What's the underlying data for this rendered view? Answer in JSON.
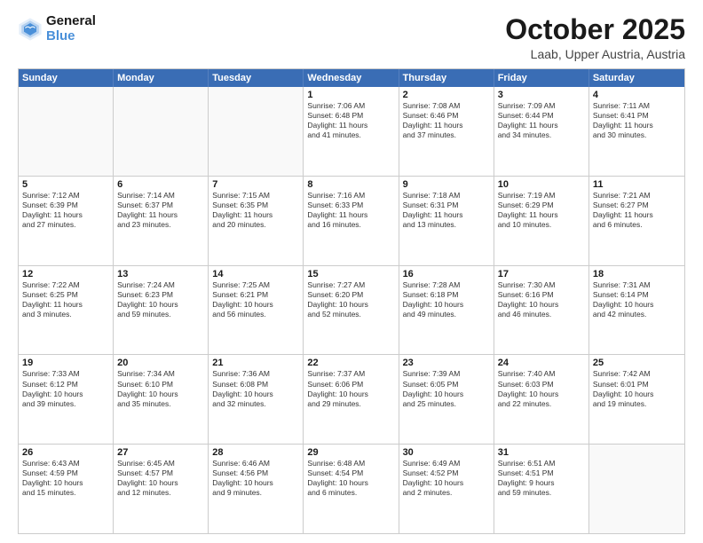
{
  "header": {
    "logo_line1": "General",
    "logo_line2": "Blue",
    "title": "October 2025",
    "subtitle": "Laab, Upper Austria, Austria"
  },
  "day_headers": [
    "Sunday",
    "Monday",
    "Tuesday",
    "Wednesday",
    "Thursday",
    "Friday",
    "Saturday"
  ],
  "weeks": [
    [
      {
        "num": "",
        "info": "",
        "empty": true
      },
      {
        "num": "",
        "info": "",
        "empty": true
      },
      {
        "num": "",
        "info": "",
        "empty": true
      },
      {
        "num": "1",
        "info": "Sunrise: 7:06 AM\nSunset: 6:48 PM\nDaylight: 11 hours\nand 41 minutes."
      },
      {
        "num": "2",
        "info": "Sunrise: 7:08 AM\nSunset: 6:46 PM\nDaylight: 11 hours\nand 37 minutes."
      },
      {
        "num": "3",
        "info": "Sunrise: 7:09 AM\nSunset: 6:44 PM\nDaylight: 11 hours\nand 34 minutes."
      },
      {
        "num": "4",
        "info": "Sunrise: 7:11 AM\nSunset: 6:41 PM\nDaylight: 11 hours\nand 30 minutes."
      }
    ],
    [
      {
        "num": "5",
        "info": "Sunrise: 7:12 AM\nSunset: 6:39 PM\nDaylight: 11 hours\nand 27 minutes."
      },
      {
        "num": "6",
        "info": "Sunrise: 7:14 AM\nSunset: 6:37 PM\nDaylight: 11 hours\nand 23 minutes."
      },
      {
        "num": "7",
        "info": "Sunrise: 7:15 AM\nSunset: 6:35 PM\nDaylight: 11 hours\nand 20 minutes."
      },
      {
        "num": "8",
        "info": "Sunrise: 7:16 AM\nSunset: 6:33 PM\nDaylight: 11 hours\nand 16 minutes."
      },
      {
        "num": "9",
        "info": "Sunrise: 7:18 AM\nSunset: 6:31 PM\nDaylight: 11 hours\nand 13 minutes."
      },
      {
        "num": "10",
        "info": "Sunrise: 7:19 AM\nSunset: 6:29 PM\nDaylight: 11 hours\nand 10 minutes."
      },
      {
        "num": "11",
        "info": "Sunrise: 7:21 AM\nSunset: 6:27 PM\nDaylight: 11 hours\nand 6 minutes."
      }
    ],
    [
      {
        "num": "12",
        "info": "Sunrise: 7:22 AM\nSunset: 6:25 PM\nDaylight: 11 hours\nand 3 minutes."
      },
      {
        "num": "13",
        "info": "Sunrise: 7:24 AM\nSunset: 6:23 PM\nDaylight: 10 hours\nand 59 minutes."
      },
      {
        "num": "14",
        "info": "Sunrise: 7:25 AM\nSunset: 6:21 PM\nDaylight: 10 hours\nand 56 minutes."
      },
      {
        "num": "15",
        "info": "Sunrise: 7:27 AM\nSunset: 6:20 PM\nDaylight: 10 hours\nand 52 minutes."
      },
      {
        "num": "16",
        "info": "Sunrise: 7:28 AM\nSunset: 6:18 PM\nDaylight: 10 hours\nand 49 minutes."
      },
      {
        "num": "17",
        "info": "Sunrise: 7:30 AM\nSunset: 6:16 PM\nDaylight: 10 hours\nand 46 minutes."
      },
      {
        "num": "18",
        "info": "Sunrise: 7:31 AM\nSunset: 6:14 PM\nDaylight: 10 hours\nand 42 minutes."
      }
    ],
    [
      {
        "num": "19",
        "info": "Sunrise: 7:33 AM\nSunset: 6:12 PM\nDaylight: 10 hours\nand 39 minutes."
      },
      {
        "num": "20",
        "info": "Sunrise: 7:34 AM\nSunset: 6:10 PM\nDaylight: 10 hours\nand 35 minutes."
      },
      {
        "num": "21",
        "info": "Sunrise: 7:36 AM\nSunset: 6:08 PM\nDaylight: 10 hours\nand 32 minutes."
      },
      {
        "num": "22",
        "info": "Sunrise: 7:37 AM\nSunset: 6:06 PM\nDaylight: 10 hours\nand 29 minutes."
      },
      {
        "num": "23",
        "info": "Sunrise: 7:39 AM\nSunset: 6:05 PM\nDaylight: 10 hours\nand 25 minutes."
      },
      {
        "num": "24",
        "info": "Sunrise: 7:40 AM\nSunset: 6:03 PM\nDaylight: 10 hours\nand 22 minutes."
      },
      {
        "num": "25",
        "info": "Sunrise: 7:42 AM\nSunset: 6:01 PM\nDaylight: 10 hours\nand 19 minutes."
      }
    ],
    [
      {
        "num": "26",
        "info": "Sunrise: 6:43 AM\nSunset: 4:59 PM\nDaylight: 10 hours\nand 15 minutes."
      },
      {
        "num": "27",
        "info": "Sunrise: 6:45 AM\nSunset: 4:57 PM\nDaylight: 10 hours\nand 12 minutes."
      },
      {
        "num": "28",
        "info": "Sunrise: 6:46 AM\nSunset: 4:56 PM\nDaylight: 10 hours\nand 9 minutes."
      },
      {
        "num": "29",
        "info": "Sunrise: 6:48 AM\nSunset: 4:54 PM\nDaylight: 10 hours\nand 6 minutes."
      },
      {
        "num": "30",
        "info": "Sunrise: 6:49 AM\nSunset: 4:52 PM\nDaylight: 10 hours\nand 2 minutes."
      },
      {
        "num": "31",
        "info": "Sunrise: 6:51 AM\nSunset: 4:51 PM\nDaylight: 9 hours\nand 59 minutes."
      },
      {
        "num": "",
        "info": "",
        "empty": true
      }
    ]
  ]
}
